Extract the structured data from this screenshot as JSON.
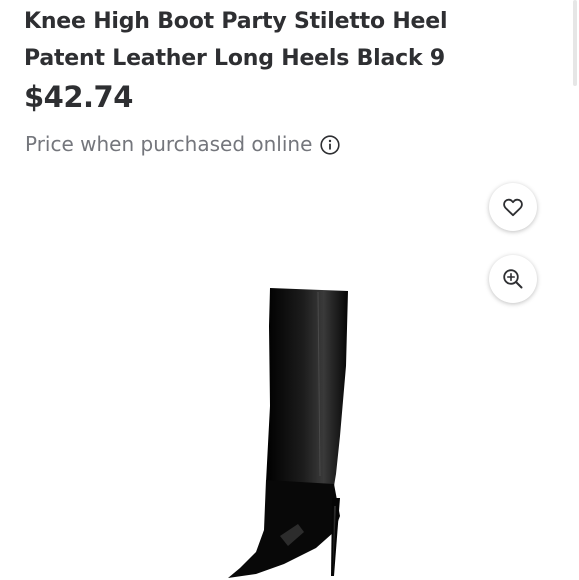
{
  "product": {
    "title_line1": "Knee High Boot Party Stiletto Heel",
    "title_line2": "Patent Leather Long Heels Black 9",
    "price": "$42.74",
    "price_note": "Price when purchased online"
  },
  "icons": {
    "info": "info-circle-icon",
    "favorite": "heart-outline-icon",
    "zoom": "zoom-in-icon"
  },
  "colors": {
    "text": "#2e2f32",
    "muted": "#74767c",
    "boot": "#0b0b0b"
  }
}
